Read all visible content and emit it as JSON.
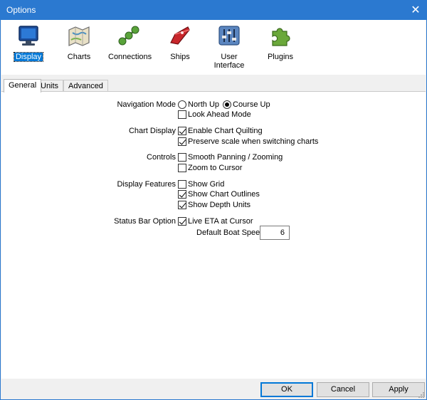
{
  "window": {
    "title": "Options",
    "close_glyph": "✕"
  },
  "toolbar": {
    "items": [
      {
        "label": "Display",
        "icon": "monitor-icon",
        "selected": true
      },
      {
        "label": "Charts",
        "icon": "chart-map-icon"
      },
      {
        "label": "Connections",
        "icon": "connections-icon"
      },
      {
        "label": "Ships",
        "icon": "ship-icon"
      },
      {
        "label": "User Interface",
        "icon": "sliders-icon"
      },
      {
        "label": "Plugins",
        "icon": "puzzle-icon"
      }
    ]
  },
  "tabs": [
    {
      "label": "General",
      "active": true
    },
    {
      "label": "Units"
    },
    {
      "label": "Advanced"
    }
  ],
  "general": {
    "navigation_mode": {
      "label": "Navigation Mode",
      "north_up": {
        "label": "North Up",
        "checked": false
      },
      "course_up": {
        "label": "Course Up",
        "checked": true
      },
      "look_ahead": {
        "label": "Look Ahead Mode",
        "checked": false
      }
    },
    "chart_display": {
      "label": "Chart Display",
      "quilting": {
        "label": "Enable Chart Quilting",
        "checked": true
      },
      "preserve_scale": {
        "label": "Preserve scale when switching charts",
        "checked": true
      }
    },
    "controls": {
      "label": "Controls",
      "smooth_panning": {
        "label": "Smooth Panning / Zooming",
        "checked": false
      },
      "zoom_to_cursor": {
        "label": "Zoom to Cursor",
        "checked": false
      }
    },
    "display_features": {
      "label": "Display Features",
      "show_grid": {
        "label": "Show Grid",
        "checked": false
      },
      "chart_outlines": {
        "label": "Show Chart Outlines",
        "checked": true
      },
      "depth_units": {
        "label": "Show Depth Units",
        "checked": true
      }
    },
    "status_bar": {
      "label": "Status Bar Option",
      "live_eta": {
        "label": "Live ETA at Cursor",
        "checked": true
      },
      "boat_speed_label": "Default Boat Speed",
      "boat_speed_value": "6"
    }
  },
  "buttons": {
    "ok": "OK",
    "cancel": "Cancel",
    "apply": "Apply"
  }
}
